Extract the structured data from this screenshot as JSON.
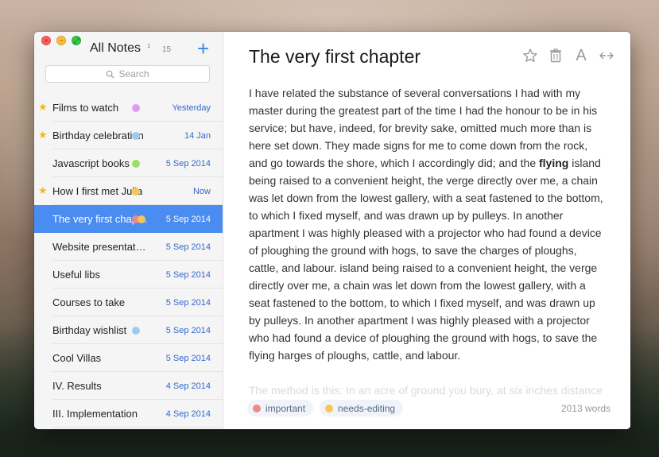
{
  "sidebar": {
    "header": {
      "title": "All Notes",
      "count": "15",
      "sort_glyph": "↕",
      "add_label": "+"
    },
    "search": {
      "placeholder": "Search"
    },
    "notes": [
      {
        "title": "Films to watch",
        "date": "Yesterday",
        "starred": true,
        "tags": [
          "#de9cf0"
        ]
      },
      {
        "title": "Birthday celebration",
        "date": "14 Jan",
        "starred": true,
        "tags": [
          "#9ccbf0"
        ]
      },
      {
        "title": "Javascript books",
        "date": "5 Sep 2014",
        "starred": false,
        "tags": [
          "#9be062"
        ]
      },
      {
        "title": "How I first met Julia",
        "date": "Now",
        "starred": true,
        "tags": [
          "#f6c65a"
        ]
      },
      {
        "title": "The very first chapter",
        "date": "5 Sep 2014",
        "starred": false,
        "selected": true,
        "tags": [
          "#f08888",
          "#f6c65a"
        ]
      },
      {
        "title": "Website presentation",
        "date": "5 Sep 2014",
        "starred": false,
        "tags": []
      },
      {
        "title": "Useful libs",
        "date": "5 Sep 2014",
        "starred": false,
        "tags": []
      },
      {
        "title": "Courses to take",
        "date": "5 Sep 2014",
        "starred": false,
        "tags": []
      },
      {
        "title": "Birthday wishlist",
        "date": "5 Sep 2014",
        "starred": false,
        "tags": [
          "#9ccbf0"
        ]
      },
      {
        "title": "Cool Villas",
        "date": "5 Sep 2014",
        "starred": false,
        "tags": []
      },
      {
        "title": "IV. Results",
        "date": "4 Sep 2014",
        "starred": false,
        "tags": []
      },
      {
        "title": "III. Implementation",
        "date": "4 Sep 2014",
        "starred": false,
        "tags": []
      }
    ]
  },
  "note": {
    "title": "The very first chapter",
    "body_before": "I have related the substance of several conversations I had with my master during the greatest part of the time I had the honour to be in his service; but have, indeed, for brevity sake, omitted much more than is here set down. They made signs for me to come down from the rock, and go towards the shore, which I accordingly did; and the ",
    "body_bold": "flying",
    "body_after": " island being raised to a convenient height, the verge directly over me, a chain was let down from the lowest gallery, with a seat fastened to the bottom, to which I fixed myself, and was drawn up by pulleys. In another apartment I was highly pleased with a projector who had found a device of ploughing the ground with hogs, to save the charges of ploughs, cattle, and labour. island being raised to a convenient height, the verge directly over me, a chain was let down from the lowest gallery, with a seat fastened to the bottom, to which I fixed myself, and was drawn up by pulleys. In another apartment I was highly pleased with a projector who had found a device of ploughing the ground with hogs, to save the flying harges of ploughs, cattle, and labour.",
    "faded_line": "The method is this: In an acre of ground you bury, at six inches distance",
    "tags": [
      {
        "label": "important",
        "color": "#f08888"
      },
      {
        "label": "needs-editing",
        "color": "#f6c65a"
      }
    ],
    "word_count": "2013 words"
  },
  "toolbar": {
    "star_icon": "star-icon",
    "trash_icon": "trash-icon",
    "font_label": "A",
    "expand_icon": "expand-arrows-icon"
  },
  "window": {
    "close_glyph": "×",
    "minimize_glyph": "−",
    "zoom_glyph": "⤢"
  }
}
